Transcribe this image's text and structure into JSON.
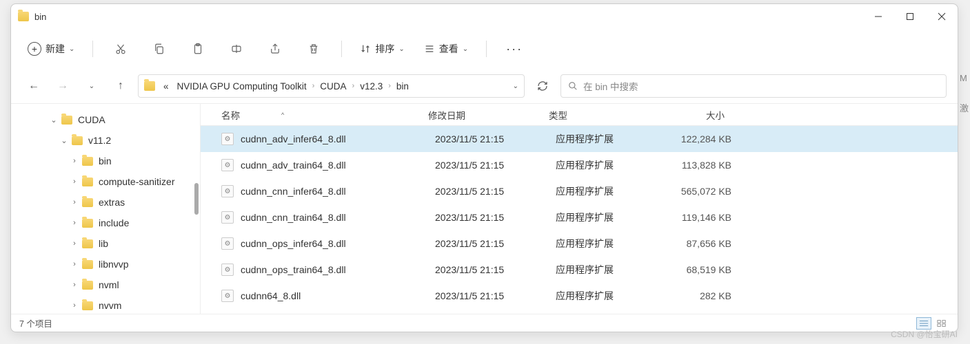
{
  "window": {
    "title": "bin"
  },
  "toolbar": {
    "new_label": "新建",
    "sort_label": "排序",
    "view_label": "查看"
  },
  "breadcrumbs": {
    "prefix": "«",
    "items": [
      "NVIDIA GPU Computing Toolkit",
      "CUDA",
      "v12.3",
      "bin"
    ]
  },
  "search": {
    "placeholder": "在 bin 中搜索"
  },
  "sidebar": {
    "items": [
      {
        "label": "CUDA",
        "indent": 55,
        "expander": "d"
      },
      {
        "label": "v11.2",
        "indent": 70,
        "expander": "d"
      },
      {
        "label": "bin",
        "indent": 85,
        "expander": "r"
      },
      {
        "label": "compute-sanitizer",
        "indent": 85,
        "expander": "r"
      },
      {
        "label": "extras",
        "indent": 85,
        "expander": "r"
      },
      {
        "label": "include",
        "indent": 85,
        "expander": "r"
      },
      {
        "label": "lib",
        "indent": 85,
        "expander": "r"
      },
      {
        "label": "libnvvp",
        "indent": 85,
        "expander": "r"
      },
      {
        "label": "nvml",
        "indent": 85,
        "expander": "r"
      },
      {
        "label": "nvvm",
        "indent": 85,
        "expander": "r"
      }
    ]
  },
  "columns": {
    "name": "名称",
    "date": "修改日期",
    "type": "类型",
    "size": "大小"
  },
  "files": [
    {
      "name": "cudnn_adv_infer64_8.dll",
      "date": "2023/11/5 21:15",
      "type": "应用程序扩展",
      "size": "122,284 KB",
      "selected": true
    },
    {
      "name": "cudnn_adv_train64_8.dll",
      "date": "2023/11/5 21:15",
      "type": "应用程序扩展",
      "size": "113,828 KB",
      "selected": false
    },
    {
      "name": "cudnn_cnn_infer64_8.dll",
      "date": "2023/11/5 21:15",
      "type": "应用程序扩展",
      "size": "565,072 KB",
      "selected": false
    },
    {
      "name": "cudnn_cnn_train64_8.dll",
      "date": "2023/11/5 21:15",
      "type": "应用程序扩展",
      "size": "119,146 KB",
      "selected": false
    },
    {
      "name": "cudnn_ops_infer64_8.dll",
      "date": "2023/11/5 21:15",
      "type": "应用程序扩展",
      "size": "87,656 KB",
      "selected": false
    },
    {
      "name": "cudnn_ops_train64_8.dll",
      "date": "2023/11/5 21:15",
      "type": "应用程序扩展",
      "size": "68,519 KB",
      "selected": false
    },
    {
      "name": "cudnn64_8.dll",
      "date": "2023/11/5 21:15",
      "type": "应用程序扩展",
      "size": "282 KB",
      "selected": false
    }
  ],
  "status": {
    "count_label": "7 个项目"
  },
  "watermark": "CSDN @怡宝研AI",
  "side_letters": [
    "M",
    "激"
  ]
}
